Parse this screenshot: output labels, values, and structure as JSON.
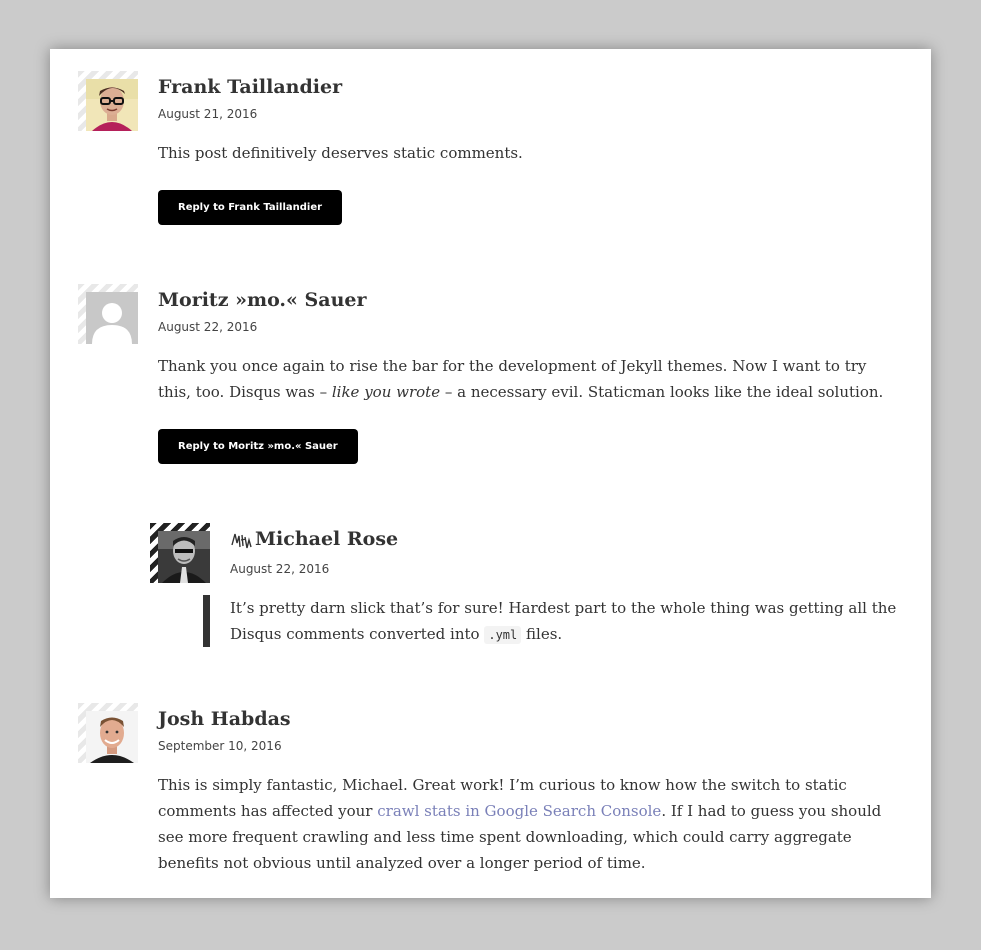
{
  "comments": [
    {
      "author": "Frank Taillandier",
      "date": "August 21, 2016",
      "text": "This post definitively deserves static comments.",
      "reply_label": "Reply to Frank Taillandier"
    },
    {
      "author": "Moritz »mo.« Sauer",
      "date": "August 22, 2016",
      "text_a": "Thank you once again to rise the bar for the development of Jekyll themes. Now I want to try this, too. Disqus was – ",
      "text_em": "like you wrote",
      "text_b": " – a necessary evil. Staticman looks like the ideal solution.",
      "reply_label": "Reply to Moritz »mo.« Sauer"
    },
    {
      "author": "Michael Rose",
      "date": "August 22, 2016",
      "text_a": "It’s pretty darn slick that’s for sure! Hardest part to the whole thing was getting all the Disqus comments converted into ",
      "code": ".yml",
      "text_b": " files."
    },
    {
      "author": "Josh Habdas",
      "date": "September 10, 2016",
      "text_a": "This is simply fantastic, Michael. Great work! I’m curious to know how the switch to static comments has affected your ",
      "link": "crawl stats in Google Search Console",
      "text_b": ". If I had to guess you should see more frequent crawling and less time spent downloading, which could carry aggregate benefits not obvious until analyzed over a longer period of time."
    }
  ]
}
